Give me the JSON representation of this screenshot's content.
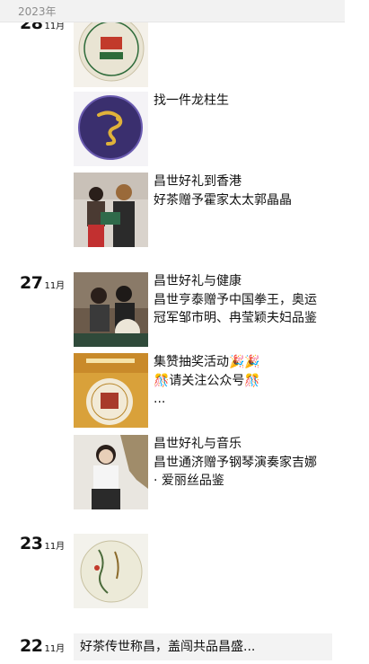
{
  "year_label": "2023年",
  "groups": [
    {
      "day": "28",
      "month": "11月"
    },
    {
      "day": "27",
      "month": "11月"
    },
    {
      "day": "23",
      "month": "11月"
    },
    {
      "day": "22",
      "month": "11月"
    }
  ],
  "posts": {
    "p1": {
      "title": "找一件龙柱生"
    },
    "p2": {
      "line1": "昌世好礼到香港",
      "line2": "好茶赠予霍家太太郭晶晶"
    },
    "p3": {
      "line1": "昌世好礼与健康",
      "line2": "昌世亨泰赠予中国拳王，奥运",
      "line3": "冠军邹市明、冉莹颖夫妇品鉴"
    },
    "p4": {
      "line1": "集赞抽奖活动🎉🎉",
      "line2": "🎊请关注公众号🎊",
      "line3": "..."
    },
    "p5": {
      "line1": "昌世好礼与音乐",
      "line2": "昌世通济赠予钢琴演奏家吉娜",
      "line3": "· 爱丽丝品鉴"
    },
    "p6": {
      "banner": "好茶传世称昌，盖闯共品昌盛..."
    }
  },
  "colors": {
    "year_bar_bg": "#f2f2f2",
    "banner_bg": "#f3f3f3",
    "text": "#111111",
    "muted": "#8c8c8c"
  }
}
